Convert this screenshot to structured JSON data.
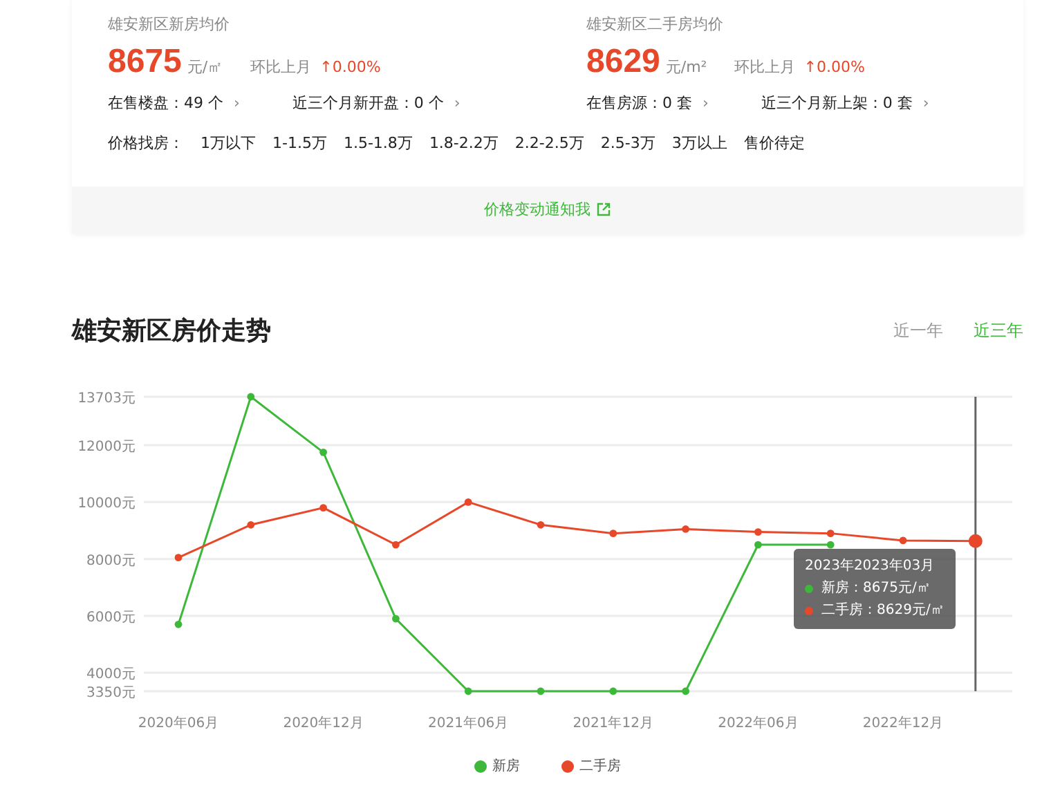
{
  "summary": {
    "blocks": [
      {
        "title": "雄安新区新房均价",
        "price": "8675",
        "unit": "元/㎡",
        "compare_label": "环比上月",
        "change": "↑0.00%",
        "links": [
          {
            "text": "在售楼盘：49 个",
            "arrow": "›"
          },
          {
            "text": "近三个月新开盘：0 个",
            "arrow": "›"
          }
        ]
      },
      {
        "title": "雄安新区二手房均价",
        "price": "8629",
        "unit": "元/m²",
        "compare_label": "环比上月",
        "change": "↑0.00%",
        "links": [
          {
            "text": "在售房源：0 套",
            "arrow": "›"
          },
          {
            "text": "近三个月新上架：0 套",
            "arrow": "›"
          }
        ]
      }
    ],
    "price_filter": {
      "label": "价格找房：",
      "options": [
        "1万以下",
        "1-1.5万",
        "1.5-1.8万",
        "1.8-2.2万",
        "2.2-2.5万",
        "2.5-3万",
        "3万以上",
        "售价待定"
      ]
    },
    "notify": "价格变动通知我"
  },
  "trend": {
    "title": "雄安新区房价走势",
    "ranges": [
      {
        "label": "近一年",
        "selected": false
      },
      {
        "label": "近三年",
        "selected": true
      }
    ],
    "chart_data": {
      "type": "line",
      "categories": [
        "2020年06月",
        null,
        "2020年12月",
        null,
        "2021年06月",
        null,
        "2021年12月",
        null,
        "2022年06月",
        null,
        "2022年12月",
        null
      ],
      "grid": true,
      "ylim": [
        3350,
        13703
      ],
      "yticks": [
        {
          "value": 3350,
          "label": "3350元"
        },
        {
          "value": 4000,
          "label": "4000元"
        },
        {
          "value": 6000,
          "label": "6000元"
        },
        {
          "value": 8000,
          "label": "8000元"
        },
        {
          "value": 10000,
          "label": "10000元"
        },
        {
          "value": 12000,
          "label": "12000元"
        },
        {
          "value": 13703,
          "label": "13703元"
        }
      ],
      "series": [
        {
          "name": "新房",
          "color": "#3db83a",
          "marker": "circle",
          "values": [
            5700,
            13703,
            11750,
            5900,
            3350,
            3350,
            3350,
            3350,
            8500,
            8500,
            null,
            null
          ]
        },
        {
          "name": "二手房",
          "color": "#e8482a",
          "marker": "circle",
          "values": [
            8050,
            9200,
            9800,
            8500,
            10000,
            9200,
            8900,
            9050,
            8950,
            8900,
            8650,
            8629
          ]
        }
      ]
    },
    "tooltip": {
      "title": "2023年2023年03月",
      "rows": [
        "新房：8675元/㎡",
        "二手房：8629元/㎡"
      ]
    }
  }
}
